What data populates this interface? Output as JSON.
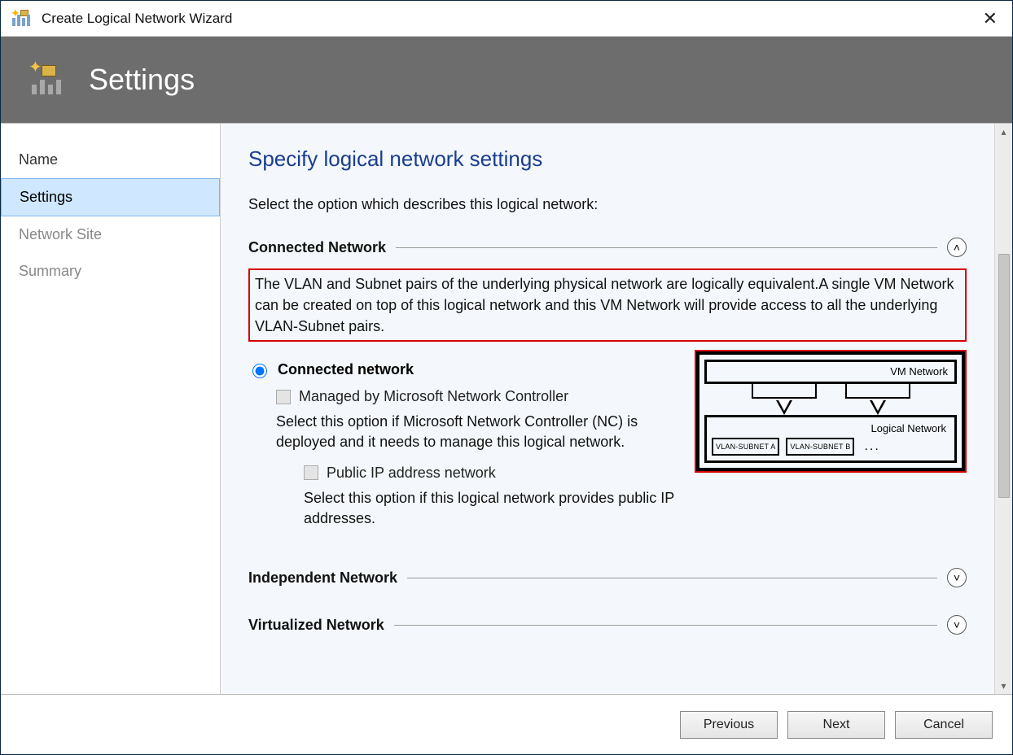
{
  "window": {
    "title": "Create Logical Network Wizard"
  },
  "banner": {
    "title": "Settings"
  },
  "sidebar": {
    "steps": [
      {
        "label": "Name",
        "state": "done"
      },
      {
        "label": "Settings",
        "state": "current"
      },
      {
        "label": "Network Site",
        "state": "future"
      },
      {
        "label": "Summary",
        "state": "future"
      }
    ]
  },
  "page": {
    "heading": "Specify logical network settings",
    "intro": "Select the option which describes this logical network:"
  },
  "sections": {
    "connected": {
      "title": "Connected Network",
      "expanded": true,
      "description": "The VLAN and Subnet pairs of the underlying physical network are logically equivalent.A single VM Network can be created on top of this logical network and this VM Network will provide access to all the underlying VLAN-Subnet pairs.",
      "radio_label": "Connected network",
      "radio_selected": true,
      "managed_label": "Managed by Microsoft Network Controller",
      "managed_help": "Select this option if Microsoft Network Controller (NC) is deployed and it needs to manage this logical network.",
      "publicip_label": "Public IP address network",
      "publicip_help": "Select this option if this logical network provides public IP addresses.",
      "diagram": {
        "vm_label": "VM Network",
        "logical_label": "Logical Network",
        "subnet_a": "VLAN-SUBNET A",
        "subnet_b": "VLAN-SUBNET B",
        "ellipsis": "..."
      }
    },
    "independent": {
      "title": "Independent Network",
      "expanded": false
    },
    "virtualized": {
      "title": "Virtualized Network",
      "expanded": false
    }
  },
  "footer": {
    "previous": "Previous",
    "next": "Next",
    "cancel": "Cancel"
  }
}
